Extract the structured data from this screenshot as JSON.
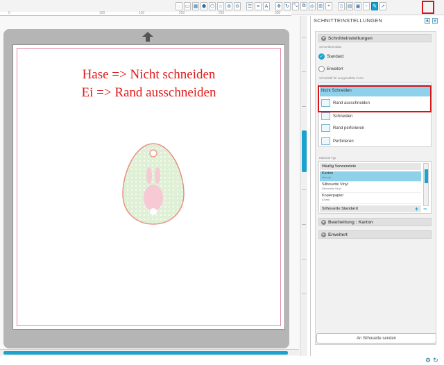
{
  "toolbar": {
    "ruler_ticks": [
      "0",
      "100",
      "150",
      "200",
      "250",
      "300"
    ],
    "icons": [
      "select-icon",
      "shape-rect-icon",
      "grid-icon",
      "pentagon-icon",
      "polygon-icon",
      "star-icon",
      "zoom-in-icon",
      "zoom-out-icon",
      "align-icon",
      "distribute-icon",
      "text-icon",
      "move-icon",
      "rotate-icon",
      "scale-icon",
      "replicate-icon",
      "offset-icon",
      "modify-icon",
      "trace-icon",
      "page-setup-icon",
      "send-icon",
      "registration-icon",
      "cut-settings-icon",
      "knife-icon"
    ],
    "active_icon": "cut-settings-icon"
  },
  "canvas": {
    "note_line1": "Hase => Nicht schneiden",
    "note_line2": "Ei => Rand ausschneiden",
    "note_color": "#e01b1b"
  },
  "panel": {
    "title": "SCHNITTEINSTELLUNGEN",
    "section_settings": "Schnitteinstellungen",
    "cut_mode_label": "Schneidemodus",
    "mode_standard": "Standard",
    "mode_advanced": "Erweitert",
    "cut_style_label": "Schnittstil für ausgewählte Form",
    "cut_styles": [
      "Nicht Schneiden",
      "Rand ausschneiden",
      "Schneiden",
      "Rand perforieren",
      "Perforieren"
    ],
    "selected_cut_style": "Nicht Schneiden",
    "material_label": "Material Typ",
    "material_group": "Häufig Verwendete",
    "materials": [
      {
        "name": "Karton",
        "sub": "Normal"
      },
      {
        "name": "Silhouette Vinyl",
        "sub": "Silhouette Vinyl"
      },
      {
        "name": "Kopierpapier",
        "sub": "(Glatt)"
      }
    ],
    "material_group2": "Silhouette Standard",
    "plus": "+",
    "minus": "−",
    "section_edit": "Bearbeitung : Karton",
    "section_advanced": "Erweitert",
    "send_button": "An Silhouette senden"
  },
  "highlight_color": "#d4161b",
  "accent_color": "#1aa3cf"
}
